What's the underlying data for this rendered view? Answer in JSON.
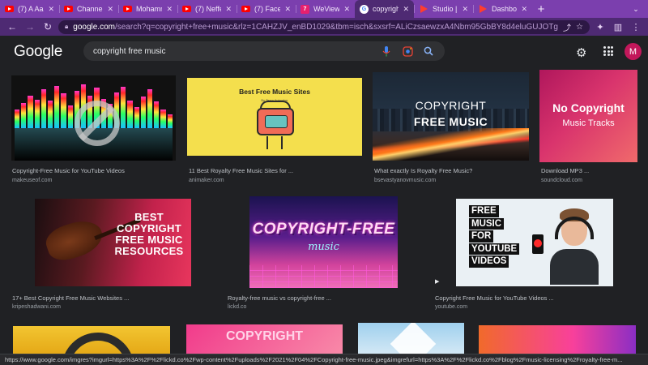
{
  "tabs": [
    {
      "label": "(7) A Aa",
      "icon": "youtube-icon",
      "active": false
    },
    {
      "label": "Channel",
      "icon": "youtube-icon",
      "active": false
    },
    {
      "label": "Mohamm",
      "icon": "youtube-icon",
      "active": false
    },
    {
      "label": "(7) Neffe",
      "icon": "youtube-icon",
      "active": false
    },
    {
      "label": "(7) Faceb",
      "icon": "youtube-icon",
      "active": false
    },
    {
      "label": "WeViewer",
      "icon": "weviewer-icon",
      "active": false
    },
    {
      "label": "copyrigh",
      "icon": "google-icon",
      "active": true
    },
    {
      "label": "Studio |",
      "icon": "studio-icon",
      "active": false
    },
    {
      "label": "Dashboa",
      "icon": "studio-icon",
      "active": false
    }
  ],
  "toolbar": {
    "url_host": "google.com",
    "url_path": "/search?q=copyright+free+music&rlz=1CAHZJV_enBD1029&tbm=isch&sxsrf=ALiCzsaewzxA4Nbm95GbBY8d4eluGUJOTg:166750772..."
  },
  "google": {
    "logo": "Google",
    "query": "copyright free music",
    "avatar_letter": "M"
  },
  "results": [
    {
      "title": "Copyright-Free Music for YouTube Videos",
      "source": "makeuseof.com"
    },
    {
      "title": "11 Best Royalty Free Music Sites for ...",
      "source": "animaker.com",
      "thumb_heading": "Best Free Music Sites",
      "thumb_sub": "By Team Animaker"
    },
    {
      "title": "What exactly Is Royalty Free Music?",
      "source": "bsevastyanovmusic.com",
      "thumb_line1": "COPYRIGHT",
      "thumb_line2": "FREE MUSIC"
    },
    {
      "title": "Download MP3 ...",
      "source": "soundcloud.com",
      "thumb_line1": "No Copyright",
      "thumb_line2": "Music Tracks"
    },
    {
      "title": "17+ Best Copyright Free Music Websites ...",
      "source": "kripeshadwani.com",
      "thumb_text": "BEST COPYRIGHT FREE MUSIC RESOURCES"
    },
    {
      "title": "Royalty-free music vs copyright-free ...",
      "source": "lickd.co",
      "thumb_line1": "COPYRIGHT-FREE",
      "thumb_line2": "music"
    },
    {
      "title": "Copyright Free Music for YouTube Videos ...",
      "source": "youtube.com",
      "thumb_words": [
        "FREE",
        "MUSIC",
        "FOR",
        "YOUTUBE",
        "VIDEOS"
      ]
    }
  ],
  "bottom_row": {
    "partial_text": "COPYRIGHT"
  },
  "status_url": "https://www.google.com/imgres?imgurl=https%3A%2F%2Flickd.co%2Fwp-content%2Fuploads%2F2021%2F04%2FCopyright-free-music.jpeg&imgrefurl=https%3A%2F%2Flickd.co%2Fblog%2Fmusic-licensing%2Froyalty-free-m..."
}
